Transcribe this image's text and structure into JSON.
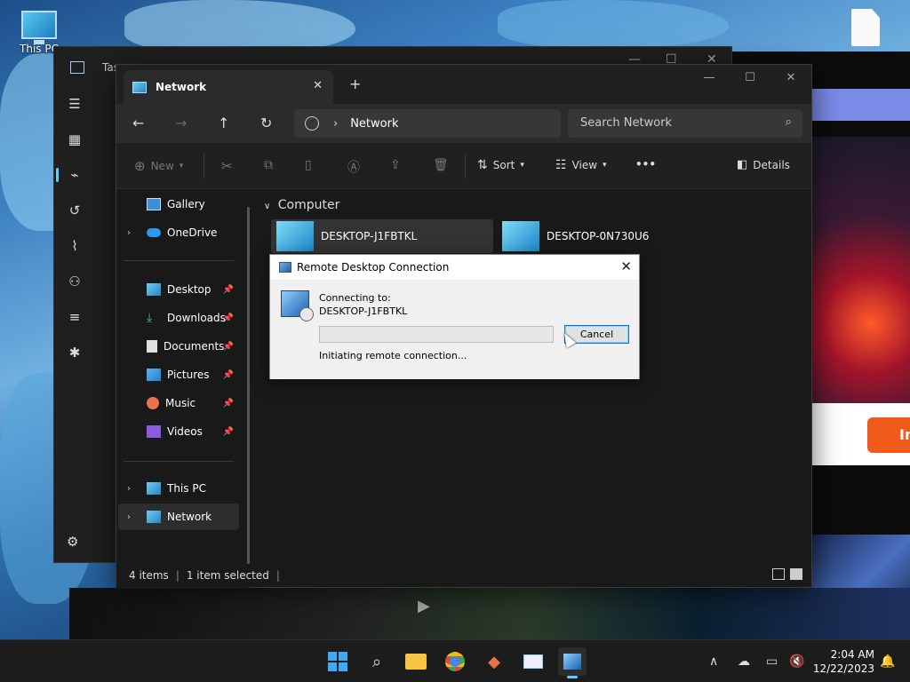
{
  "desktop": {
    "icons": [
      {
        "label": "This PC"
      }
    ]
  },
  "taskmgr": {
    "title": "Tas"
  },
  "bgapp": {
    "button_text": "In"
  },
  "explorer": {
    "tab_title": "Network",
    "address_location": "Network",
    "search_placeholder": "Search Network",
    "toolbar": {
      "new_label": "New",
      "sort_label": "Sort",
      "view_label": "View",
      "more_label": "•••",
      "details_label": "Details"
    },
    "sidebar": {
      "items": [
        {
          "label": "Gallery"
        },
        {
          "label": "OneDrive"
        },
        {
          "label": "Desktop"
        },
        {
          "label": "Downloads"
        },
        {
          "label": "Documents"
        },
        {
          "label": "Pictures"
        },
        {
          "label": "Music"
        },
        {
          "label": "Videos"
        },
        {
          "label": "This PC"
        },
        {
          "label": "Network"
        }
      ]
    },
    "content": {
      "group_label": "Computer",
      "computers": [
        {
          "name": "DESKTOP-J1FBTKL"
        },
        {
          "name": "DESKTOP-0N730U6"
        }
      ]
    },
    "status": {
      "item_count": "4 items",
      "selection": "1 item selected"
    }
  },
  "rdc_dialog": {
    "title": "Remote Desktop Connection",
    "connecting_label": "Connecting to:",
    "host": "DESKTOP-J1FBTKL",
    "progress": 0,
    "cancel_label": "Cancel",
    "status_text": "Initiating remote connection..."
  },
  "taskbar": {
    "time": "2:04 AM",
    "date": "12/22/2023"
  },
  "colors": {
    "accent": "#60cdff",
    "dialog_focus": "#0078d7",
    "explorer_bg": "#191919"
  }
}
